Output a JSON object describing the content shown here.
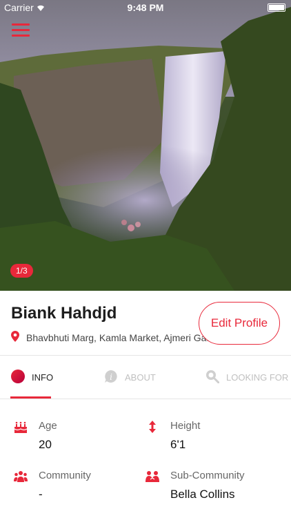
{
  "status_bar": {
    "carrier": "Carrier",
    "time": "9:48 PM"
  },
  "photo": {
    "counter": "1/3"
  },
  "profile": {
    "name": "Biank Hahdjd",
    "address": "Bhavbhuti Marg, Kamla Market, Ajmeri Gat...",
    "edit_label": "Edit Profile"
  },
  "tabs": [
    {
      "label": "INFO",
      "icon": "info-dot-icon",
      "active": true
    },
    {
      "label": "ABOUT",
      "icon": "info-bubble-icon",
      "active": false
    },
    {
      "label": "LOOKING FOR",
      "icon": "search-icon",
      "active": false
    }
  ],
  "fields": [
    {
      "label": "Age",
      "value": "20",
      "icon": "cake-icon"
    },
    {
      "label": "Height",
      "value": "6'1",
      "icon": "height-icon"
    },
    {
      "label": "Community",
      "value": "-",
      "icon": "community-icon"
    },
    {
      "label": "Sub-Community",
      "value": "Bella Collins",
      "icon": "sub-community-icon"
    }
  ],
  "colors": {
    "accent": "#e8283a",
    "inactive": "#c8c8c8"
  }
}
